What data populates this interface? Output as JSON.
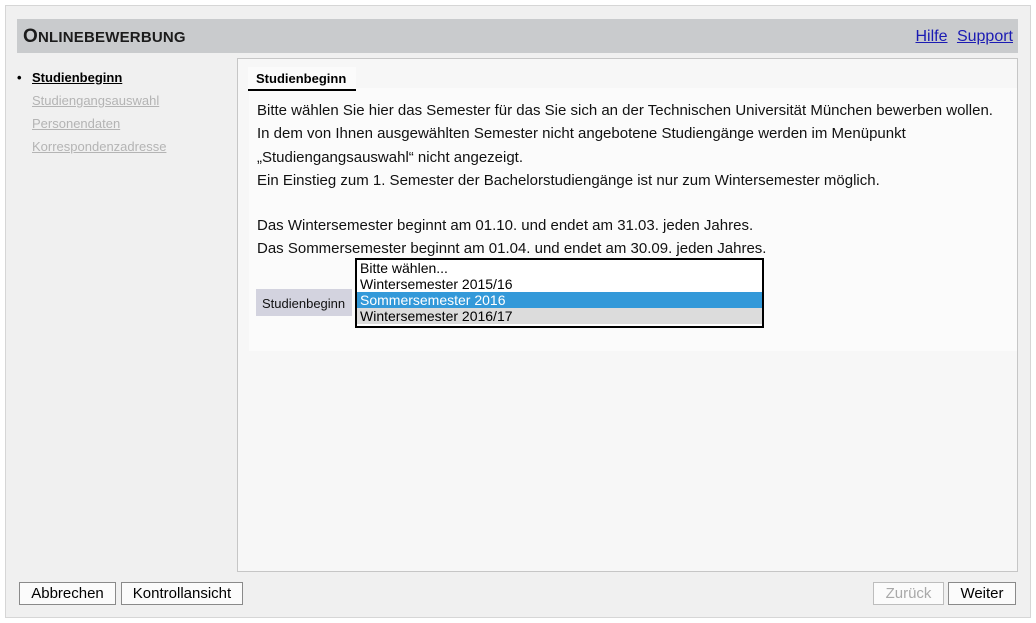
{
  "header": {
    "title_first": "O",
    "title_rest": "NLINEBEWERBUNG",
    "links": {
      "help": "Hilfe",
      "support": "Support"
    }
  },
  "sidebar": {
    "items": [
      {
        "label": "Studienbeginn",
        "active": true
      },
      {
        "label": "Studiengangsauswahl",
        "active": false
      },
      {
        "label": "Personendaten",
        "active": false
      },
      {
        "label": "Korrespondenzadresse",
        "active": false
      }
    ],
    "bullet": "•"
  },
  "main": {
    "tab_label": "Studienbeginn",
    "paragraphs": [
      "Bitte wählen Sie hier das Semester für das Sie sich an der Technischen Universität München bewerben wollen.",
      "In dem von Ihnen ausgewählten Semester nicht angebotene Studiengänge werden im Menüpunkt",
      "„Studiengangsauswahl“ nicht angezeigt.",
      "Ein Einstieg zum 1. Semester der Bachelorstudiengänge ist nur zum Wintersemester möglich.",
      "Das Wintersemester beginnt am 01.10. und endet am 31.03. jeden Jahres.",
      "Das Sommersemester beginnt am 01.04. und endet am 30.09. jeden Jahres."
    ],
    "field_label": "Studienbeginn",
    "dropdown": {
      "options": [
        "Bitte wählen...",
        "Wintersemester 2015/16",
        "Sommersemester 2016",
        "Wintersemester 2016/17"
      ],
      "selected": "Sommersemester 2016"
    }
  },
  "footer": {
    "cancel": "Abbrechen",
    "review": "Kontrollansicht",
    "back": "Zurück",
    "next": "Weiter"
  }
}
